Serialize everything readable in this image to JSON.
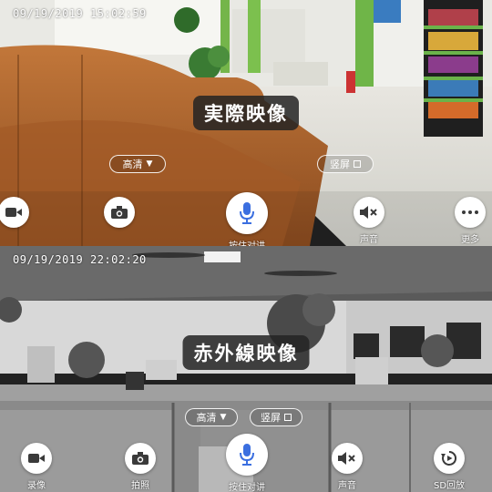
{
  "top_view": {
    "timestamp": "09/19/2019 15:02:59",
    "caption": "実際映像",
    "quality_label": "高清",
    "quality_arrow": "▼",
    "fullscreen_label": "竖屏",
    "controls": {
      "record": "",
      "snapshot": "",
      "talk": "按住对讲",
      "sound": "声音",
      "more": "更多"
    }
  },
  "bottom_view": {
    "timestamp": "09/19/2019 22:02:20",
    "caption": "赤外線映像",
    "quality_label": "高清",
    "fullscreen_label": "竖屏",
    "controls": {
      "record": "录像",
      "snapshot": "拍照",
      "talk": "按住对讲",
      "sound": "声音",
      "sd_playback": "SD回放"
    }
  },
  "colors": {
    "mic_blue": "#3b6fe0",
    "icon_dark": "#3a3a3a"
  }
}
